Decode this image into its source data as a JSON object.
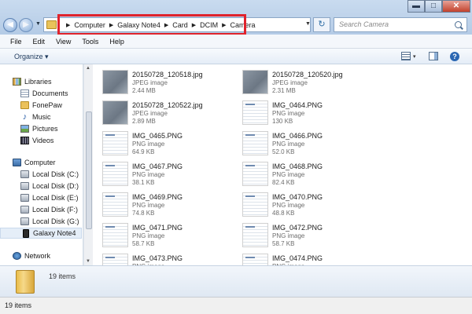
{
  "window": {
    "min_symbol": "▬",
    "max_symbol": "□",
    "close_symbol": "✕"
  },
  "nav": {
    "back_symbol": "◀",
    "forward_symbol": "▶",
    "dropdown_symbol": "▼"
  },
  "address": {
    "crumbs": [
      "Computer",
      "Galaxy Note4",
      "Card",
      "DCIM",
      "Camera"
    ],
    "separator": "▶",
    "highlight_color": "#e0232c"
  },
  "refresh_symbol": "↻",
  "search": {
    "placeholder": "Search Camera"
  },
  "menu": [
    "File",
    "Edit",
    "View",
    "Tools",
    "Help"
  ],
  "toolbar": {
    "organize_label": "Organize ▾",
    "views_drop": "▾",
    "help_symbol": "?"
  },
  "nav_pane": {
    "libraries_group": [
      {
        "label": "Libraries",
        "icon": "libraries-icon",
        "kind": "header"
      },
      {
        "label": "Documents",
        "icon": "documents-icon"
      },
      {
        "label": "FonePaw",
        "icon": "folder-icon"
      },
      {
        "label": "Music",
        "icon": "music-icon"
      },
      {
        "label": "Pictures",
        "icon": "pictures-icon"
      },
      {
        "label": "Videos",
        "icon": "videos-icon"
      }
    ],
    "computer_group": [
      {
        "label": "Computer",
        "icon": "computer-icon",
        "kind": "header"
      },
      {
        "label": "Local Disk (C:)",
        "icon": "disk-icon"
      },
      {
        "label": "Local Disk (D:)",
        "icon": "disk-icon"
      },
      {
        "label": "Local Disk (E:)",
        "icon": "disk-icon"
      },
      {
        "label": "Local Disk (F:)",
        "icon": "disk-icon"
      },
      {
        "label": "Local Disk (G:)",
        "icon": "disk-icon"
      },
      {
        "label": "Galaxy Note4",
        "icon": "phone-icon",
        "selected": true
      }
    ],
    "network": {
      "label": "Network",
      "icon": "network-icon"
    }
  },
  "files": [
    {
      "name": "20150728_120518.jpg",
      "type": "JPEG image",
      "size": "2.44 MB",
      "thumb": "photo"
    },
    {
      "name": "20150728_120520.jpg",
      "type": "JPEG image",
      "size": "2.31 MB",
      "thumb": "photo"
    },
    {
      "name": "20150728_120522.jpg",
      "type": "JPEG image",
      "size": "2.89 MB",
      "thumb": "photo"
    },
    {
      "name": "IMG_0464.PNG",
      "type": "PNG image",
      "size": "130 KB",
      "thumb": "shot"
    },
    {
      "name": "IMG_0465.PNG",
      "type": "PNG image",
      "size": "64.9 KB",
      "thumb": "shot"
    },
    {
      "name": "IMG_0466.PNG",
      "type": "PNG image",
      "size": "52.0 KB",
      "thumb": "shot"
    },
    {
      "name": "IMG_0467.PNG",
      "type": "PNG image",
      "size": "38.1 KB",
      "thumb": "shot"
    },
    {
      "name": "IMG_0468.PNG",
      "type": "PNG image",
      "size": "82.4 KB",
      "thumb": "shot"
    },
    {
      "name": "IMG_0469.PNG",
      "type": "PNG image",
      "size": "74.8 KB",
      "thumb": "shot"
    },
    {
      "name": "IMG_0470.PNG",
      "type": "PNG image",
      "size": "48.8 KB",
      "thumb": "shot"
    },
    {
      "name": "IMG_0471.PNG",
      "type": "PNG image",
      "size": "58.7 KB",
      "thumb": "shot"
    },
    {
      "name": "IMG_0472.PNG",
      "type": "PNG image",
      "size": "58.7 KB",
      "thumb": "shot"
    },
    {
      "name": "IMG_0473.PNG",
      "type": "PNG image",
      "size": "",
      "thumb": "shot"
    },
    {
      "name": "IMG_0474.PNG",
      "type": "PNG image",
      "size": "",
      "thumb": "shot"
    }
  ],
  "details": {
    "count_label": "19 items"
  },
  "status": {
    "text": "19 items"
  },
  "scrollbar": {
    "up": "▲",
    "down": "▼"
  }
}
